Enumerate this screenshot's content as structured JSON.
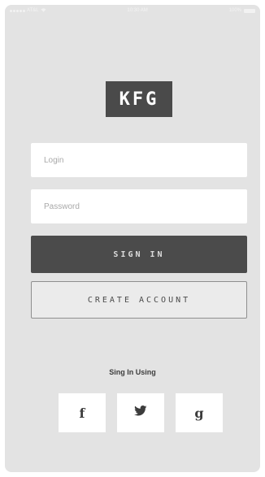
{
  "status_bar": {
    "carrier": "AT&L",
    "time": "10:30 AM",
    "battery_label": "100%"
  },
  "logo": {
    "text": "KFG"
  },
  "form": {
    "login_placeholder": "Login",
    "password_placeholder": "Password",
    "sign_in_label": "SIGN IN",
    "create_account_label": "CREATE ACCOUNT"
  },
  "alternate_signin": {
    "label": "Sing In Using",
    "providers": [
      {
        "name": "facebook",
        "icon": "facebook-icon",
        "glyph": "f"
      },
      {
        "name": "twitter",
        "icon": "twitter-icon",
        "glyph": ""
      },
      {
        "name": "google",
        "icon": "google-icon",
        "glyph": "g"
      }
    ]
  },
  "colors": {
    "background": "#e3e3e3",
    "primary": "#4b4b4b",
    "field_bg": "#ffffff"
  }
}
